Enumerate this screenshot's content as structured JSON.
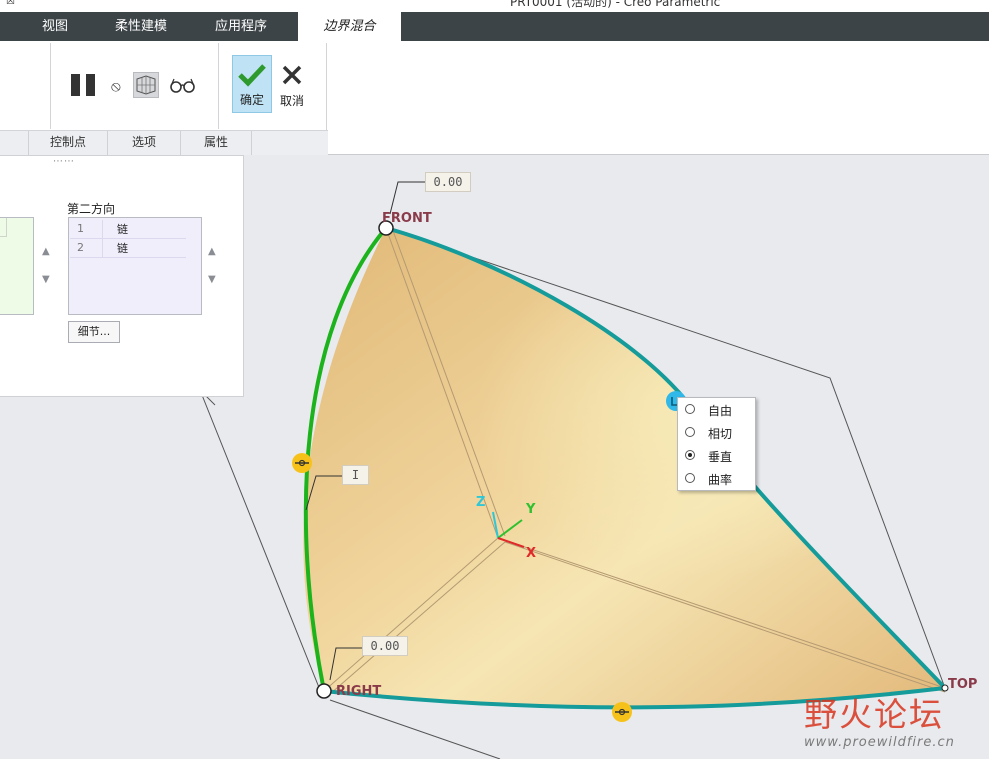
{
  "window": {
    "title": "PRT0001 (活动的) - Creo Parametric",
    "sys_glyph": "☒"
  },
  "tabs": [
    {
      "label": "视图"
    },
    {
      "label": "柔性建模"
    },
    {
      "label": "应用程序"
    },
    {
      "label": "边界混合",
      "active": true
    }
  ],
  "ribbon": {
    "ok_label": "确定",
    "cancel_label": "取消",
    "sections": [
      "控制点",
      "选项",
      "属性"
    ]
  },
  "panel": {
    "grip": "⋯⋯",
    "second_direction_title": "第二方向",
    "second_direction_rows": [
      {
        "index": "1",
        "value": "链"
      },
      {
        "index": "2",
        "value": "链"
      }
    ],
    "detail_button": "细节..."
  },
  "context_menu": {
    "items": [
      {
        "label": "自由",
        "selected": false
      },
      {
        "label": "相切",
        "selected": false
      },
      {
        "label": "垂直",
        "selected": true
      },
      {
        "label": "曲率",
        "selected": false
      }
    ]
  },
  "viewport": {
    "dim_top": "0.00",
    "dim_mid": "I",
    "dim_bottom": "0.00",
    "labels": {
      "front": "FRONT",
      "right": "RIGHT",
      "top": "TOP"
    },
    "axes": {
      "x": "X",
      "y": "Y",
      "z": "Z"
    },
    "colors": {
      "surface": "#edc98e",
      "boundary_teal": "#149b9a",
      "boundary_green": "#1db31d",
      "handle": "#f6c21a"
    }
  },
  "watermark": {
    "text": "野火论坛",
    "url": "www.proewildfire.cn"
  }
}
